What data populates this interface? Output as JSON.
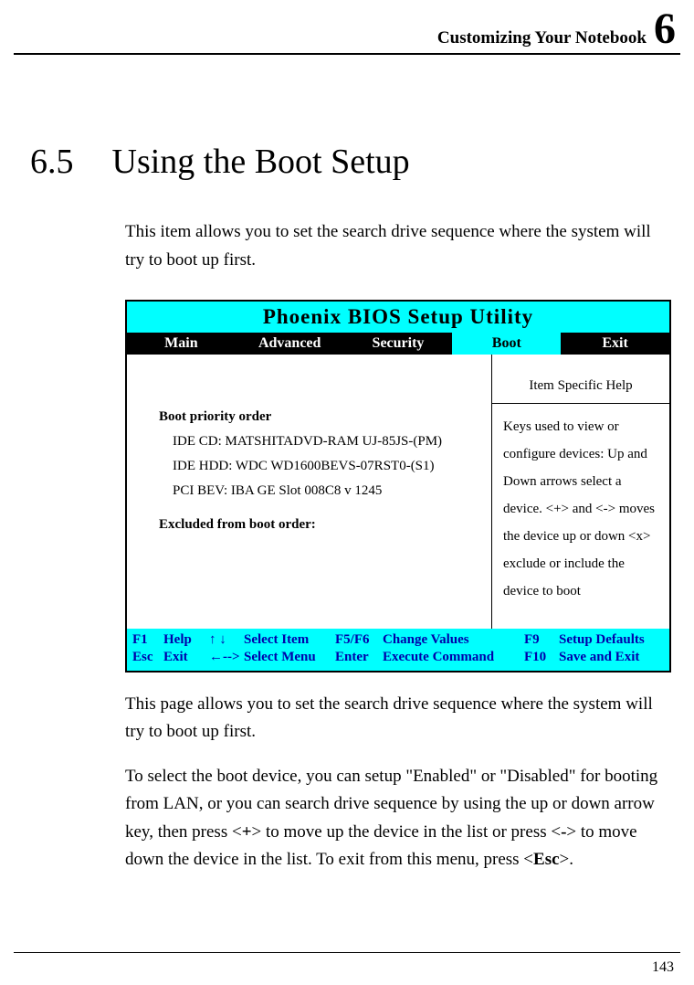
{
  "header": {
    "title": "Customizing Your Notebook",
    "chapter": "6"
  },
  "section": {
    "number": "6.5",
    "title": "Using the Boot Setup"
  },
  "para1": "This item allows you to set the search drive sequence where the system will try to boot up first.",
  "bios": {
    "title": "Phoenix BIOS Setup Utility",
    "tabs": {
      "main": "Main",
      "advanced": "Advanced",
      "security": "Security",
      "boot": "Boot",
      "exit": "Exit"
    },
    "main": {
      "priority_label": "Boot priority order",
      "item1": "IDE CD: MATSHITADVD-RAM UJ-85JS-(PM)",
      "item2": "IDE HDD: WDC WD1600BEVS-07RST0-(S1)",
      "item3": "PCI BEV: IBA GE Slot 008C8  v 1245",
      "excluded_label": "Excluded from boot order:"
    },
    "help": {
      "title": "Item Specific Help",
      "body": "Keys used to view or configure devices: Up and Down arrows select a device. <+> and <-> moves the device up or down <x> exclude or include the device to boot"
    },
    "footer": {
      "r1": {
        "k1": "F1",
        "l1": "Help",
        "arrows1": "↑ ↓",
        "a1": "Select Item",
        "k2": "F5/F6",
        "a2": "Change Values",
        "k3": "F9",
        "a3": "Setup Defaults"
      },
      "r2": {
        "k1": "Esc",
        "l1": "Exit",
        "arrows1": "←-->",
        "a1": "Select Menu",
        "k2": "Enter",
        "a2": "Execute Command",
        "k3": "F10",
        "a3": "Save and Exit"
      }
    }
  },
  "para2": "This page allows you to set the search drive sequence where the system will try to boot up first.",
  "para3_part1": "To select the boot device, you can setup \"Enabled\" or \"Disabled\" for booting from LAN, or you can search drive sequence by using the up or down arrow key, then press <",
  "para3_plus": "+",
  "para3_part2": "> to move up the device in the list or press <",
  "para3_minus": "-",
  "para3_part3": "> to move down the device in the list. To exit from this menu, press <",
  "para3_esc": "Esc",
  "para3_part4": ">.",
  "page_number": "143"
}
